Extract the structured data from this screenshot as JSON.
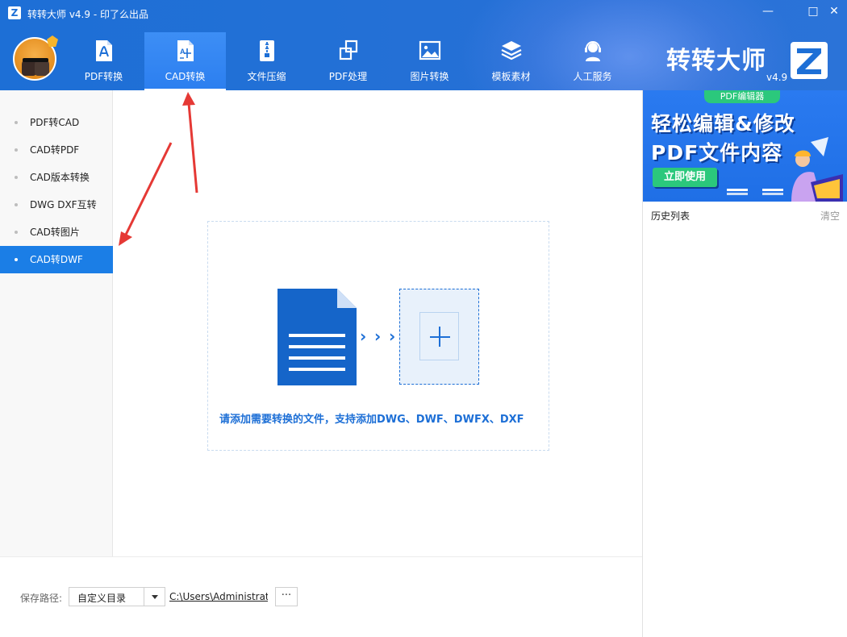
{
  "window": {
    "title": "转转大师 v4.9 - 印了么出品",
    "minimize_icon": "—",
    "maximize_icon": "□",
    "close_icon": "✕"
  },
  "nav": {
    "items": [
      {
        "label": "PDF转换",
        "icon": "pdf-icon"
      },
      {
        "label": "CAD转换",
        "icon": "cad-icon",
        "active": true
      },
      {
        "label": "文件压缩",
        "icon": "zip-icon"
      },
      {
        "label": "PDF处理",
        "icon": "pdf-process-icon"
      },
      {
        "label": "图片转换",
        "icon": "image-icon"
      },
      {
        "label": "模板素材",
        "icon": "layers-icon"
      },
      {
        "label": "人工服务",
        "icon": "headset-icon"
      }
    ]
  },
  "brand": {
    "name": "转转大师",
    "version": "v4.9"
  },
  "sidebar": {
    "items": [
      {
        "label": "PDF转CAD"
      },
      {
        "label": "CAD转PDF"
      },
      {
        "label": "CAD版本转换"
      },
      {
        "label": "DWG DXF互转"
      },
      {
        "label": "CAD转图片"
      },
      {
        "label": "CAD转DWF",
        "active": true
      }
    ]
  },
  "main": {
    "hint": "请添加需要转换的文件，支持添加DWG、DWF、DWFX、DXF",
    "chevrons": "›"
  },
  "bottom": {
    "save_label": "保存路径:",
    "select_value": "自定义目录",
    "path": "C:\\Users\\Administrat",
    "more_label": "···"
  },
  "right": {
    "banner": {
      "tag": "PDF编辑器",
      "line1": "轻松编辑&修改",
      "line2": "PDF文件内容",
      "button": "立即使用"
    },
    "history_title": "历史列表",
    "history_clear": "清空"
  },
  "colors": {
    "primary": "#1d6fd6",
    "active_nav": "#2c7ff0",
    "sidebar_active": "#1b7ee6",
    "green": "#2bc87c",
    "annotation_arrow": "#e53935"
  }
}
